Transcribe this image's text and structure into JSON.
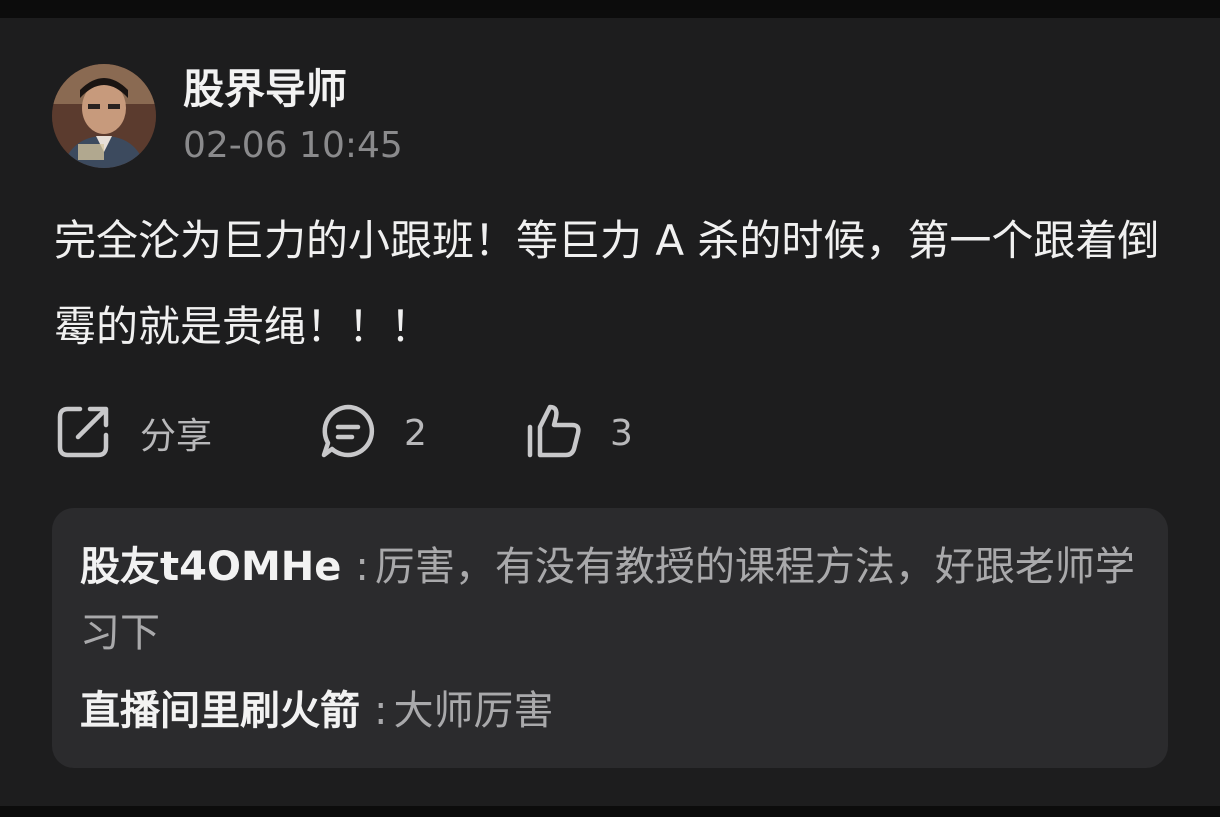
{
  "post": {
    "author": "股界导师",
    "timestamp": "02-06 10:45",
    "text": "完全沦为巨力的小跟班！等巨力 A 杀的时候，第一个跟着倒霉的就是贵绳！！！"
  },
  "actions": {
    "share_label": "分享",
    "comment_count": "2",
    "like_count": "3",
    "share_icon": "share-icon",
    "comment_icon": "comment-icon",
    "like_icon": "thumbs-up-icon"
  },
  "comments": [
    {
      "author": "股友t4OMHe",
      "separator": ":",
      "text": "厉害，有没有教授的课程方法，好跟老师学习下"
    },
    {
      "author": "直播间里刷火箭",
      "separator": ":",
      "text": "大师厉害"
    }
  ],
  "colors": {
    "background": "#1d1d1e",
    "comment_box": "#2b2b2d",
    "primary_text": "#f0f0f0",
    "secondary_text": "#8a8a8c"
  }
}
